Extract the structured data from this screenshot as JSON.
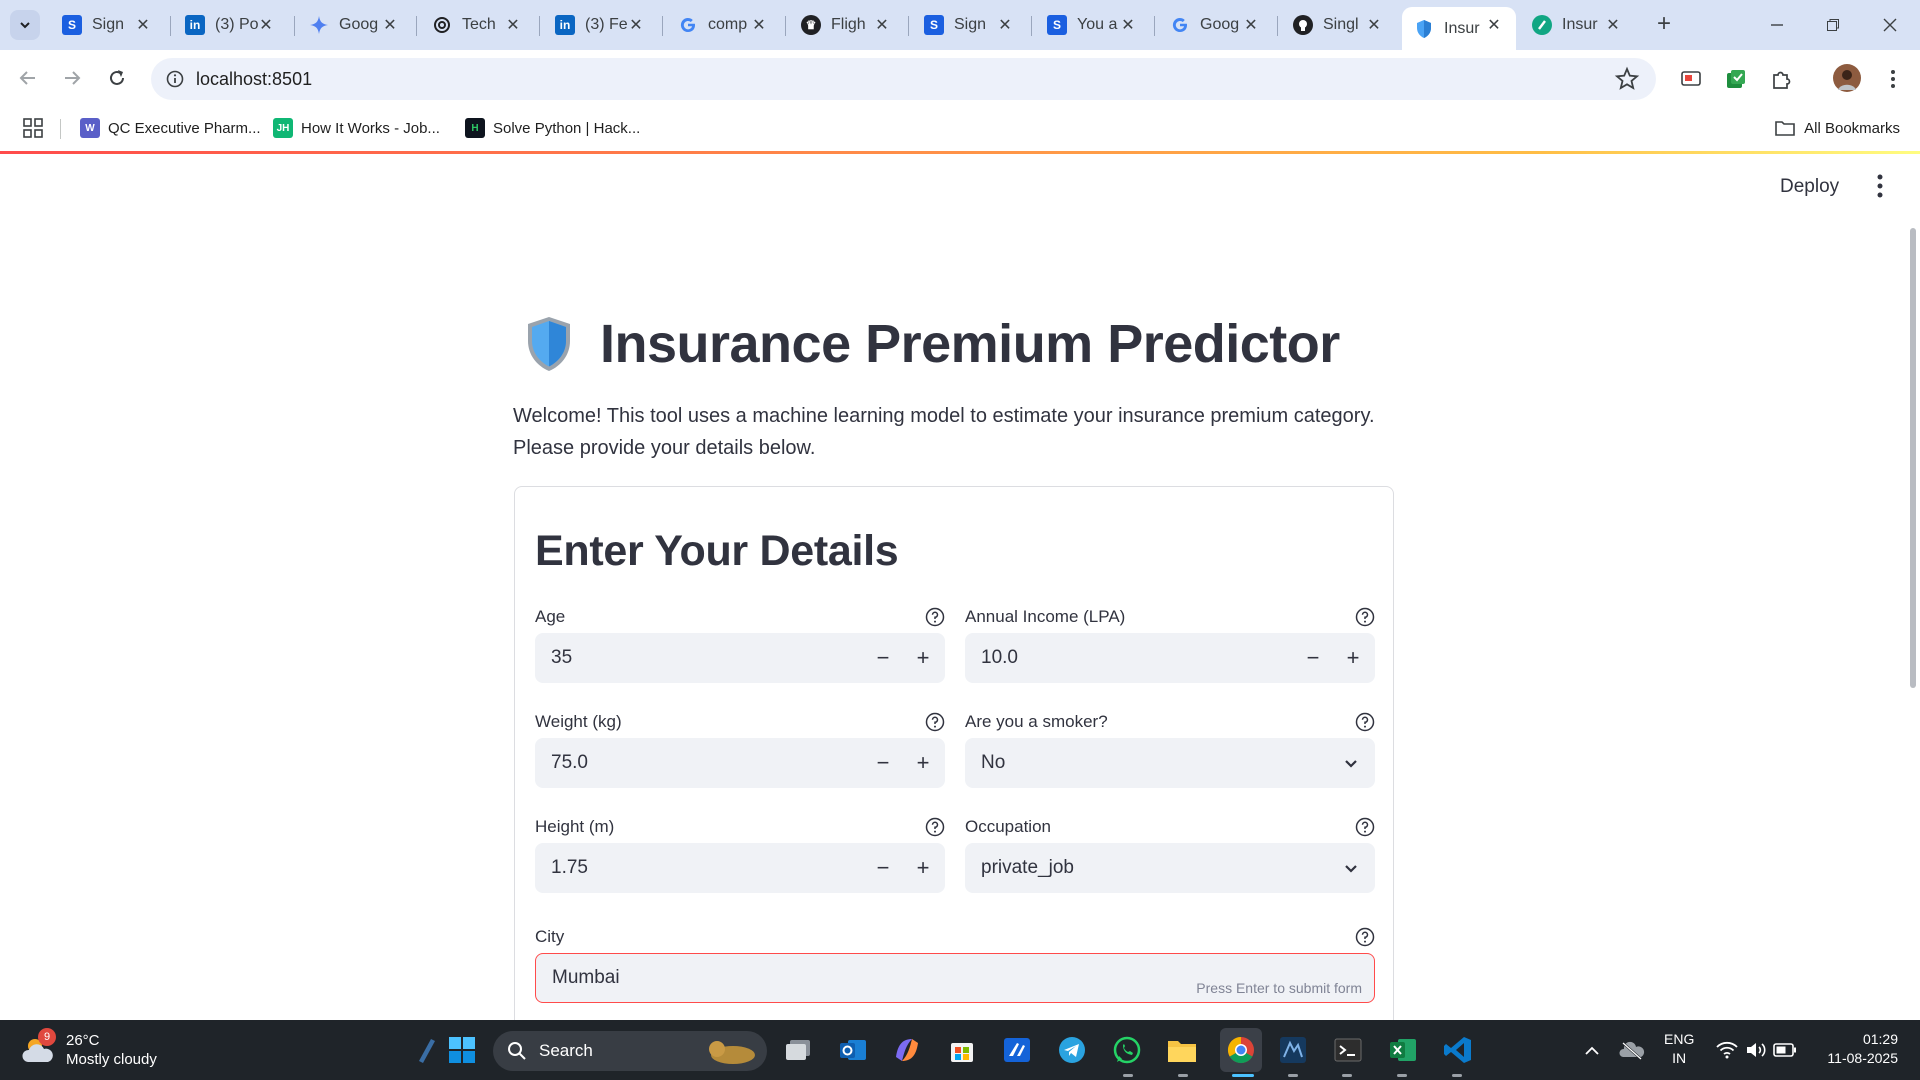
{
  "browser": {
    "tabs": [
      {
        "title": "Sign",
        "icon": "s-icon",
        "color": "#1b5fe0"
      },
      {
        "title": "(3) Po",
        "icon": "linkedin-icon",
        "color": "#0a66c2"
      },
      {
        "title": "Goog",
        "icon": "gemini-icon",
        "color": "#4f7ff0"
      },
      {
        "title": "Tech",
        "icon": "openai-icon",
        "color": "#202124"
      },
      {
        "title": "(3) Fe",
        "icon": "linkedin-icon",
        "color": "#0a66c2"
      },
      {
        "title": "comp",
        "icon": "google-icon",
        "color": "#4285f4"
      },
      {
        "title": "Fligh",
        "icon": "crown-icon",
        "color": "#202124"
      },
      {
        "title": "Sign",
        "icon": "s-icon",
        "color": "#1b5fe0"
      },
      {
        "title": "You a",
        "icon": "s-icon",
        "color": "#1b5fe0"
      },
      {
        "title": "Goog",
        "icon": "google-icon",
        "color": "#4285f4"
      },
      {
        "title": "Singl",
        "icon": "github-icon",
        "color": "#202124"
      },
      {
        "title": "Insur",
        "icon": "shield-icon",
        "color": "#4aa3f5",
        "active": true
      },
      {
        "title": "Insur",
        "icon": "streamlit-icon",
        "color": "#11a683"
      }
    ],
    "url": "localhost:8501",
    "bookmarks": [
      {
        "label": "QC Executive Pharm...",
        "icon": "w-icon"
      },
      {
        "label": "How It Works - Job...",
        "icon": "jh-icon"
      },
      {
        "label": "Solve Python | Hack...",
        "icon": "hackerrank-icon"
      }
    ],
    "all_bookmarks": "All Bookmarks"
  },
  "app": {
    "deploy_label": "Deploy",
    "title": "Insurance Premium Predictor",
    "intro": "Welcome! This tool uses a machine learning model to estimate your insurance premium category. Please provide your details below.",
    "form": {
      "title": "Enter Your Details",
      "age": {
        "label": "Age",
        "value": "35"
      },
      "income": {
        "label": "Annual Income (LPA)",
        "value": "10.0"
      },
      "weight": {
        "label": "Weight (kg)",
        "value": "75.0"
      },
      "smoker": {
        "label": "Are you a smoker?",
        "value": "No"
      },
      "height": {
        "label": "Height (m)",
        "value": "1.75"
      },
      "occupation": {
        "label": "Occupation",
        "value": "private_job"
      },
      "city": {
        "label": "City",
        "value": "Mumbai",
        "hint": "Press Enter to submit form"
      }
    },
    "colors": {
      "accent": "#ff4b4b",
      "input_bg": "#f0f2f6",
      "text": "#31333f"
    }
  },
  "taskbar": {
    "weather_badge": "9",
    "temperature": "26°C",
    "condition": "Mostly cloudy",
    "search_label": "Search",
    "language": "ENG",
    "region": "IN",
    "time": "01:29",
    "date": "11-08-2025"
  }
}
